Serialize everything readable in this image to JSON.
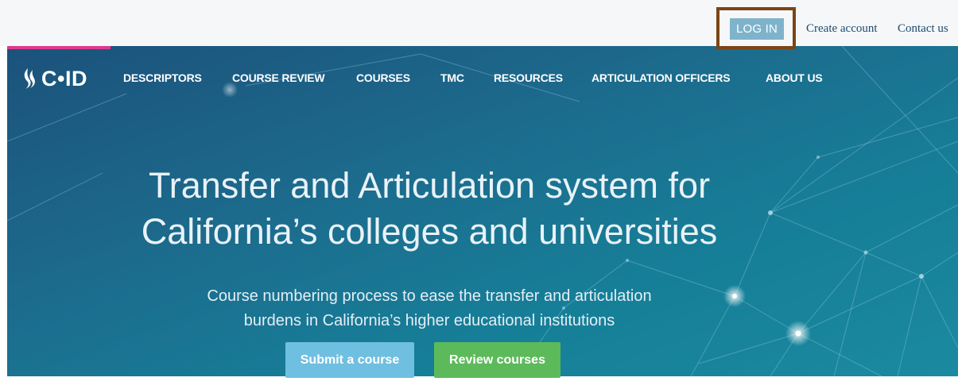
{
  "topbar": {
    "login_label": "LOG IN",
    "links": [
      "Create account",
      "Contact us"
    ]
  },
  "nav": {
    "logo_text": "C•ID",
    "items": [
      "DESCRIPTORS",
      "COURSE REVIEW",
      "COURSES",
      "TMC",
      "RESOURCES",
      "ARTICULATION OFFICERS",
      "ABOUT US"
    ]
  },
  "hero": {
    "headline_line1": "Transfer and Articulation system for",
    "headline_line2": "California’s colleges and universities",
    "subhead_line1": "Course numbering process to ease the transfer and articulation",
    "subhead_line2": "burdens in California’s higher educational institutions",
    "submit_label": "Submit a course",
    "review_label": "Review courses"
  },
  "colors": {
    "accent_pink": "#e03a8b",
    "login_bg": "#7fb3cc",
    "highlight_border": "#7a4516",
    "submit_bg": "#6fbfe0",
    "review_bg": "#5cba5a",
    "hero_bg": "#1d6c8e",
    "link_color": "#1b4a6f"
  }
}
